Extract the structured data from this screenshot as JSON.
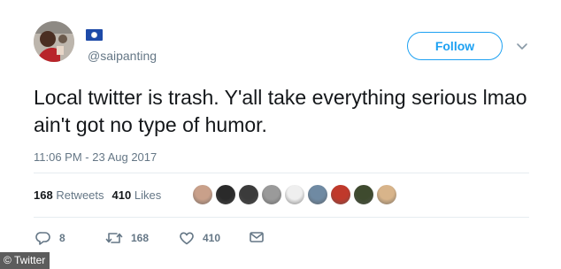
{
  "user": {
    "handle": "@saipanting",
    "flag_icon": "flag-icon",
    "colors": {
      "flag_blue": "#1d4aa8"
    }
  },
  "follow_button": {
    "label": "Follow",
    "color": "#1da1f2"
  },
  "tweet": {
    "text": "Local twitter is trash. Y'all take everything serious lmao ain't got no type of humor.",
    "timestamp": "11:06 PM - 23 Aug 2017"
  },
  "stats": {
    "retweets_count": "168",
    "retweets_label": "Retweets",
    "likes_count": "410",
    "likes_label": "Likes"
  },
  "likers": [
    {
      "icon": "liker-avatar-1",
      "color": "#c9a08a"
    },
    {
      "icon": "liker-avatar-2",
      "color": "#2a2a2a"
    },
    {
      "icon": "liker-avatar-3",
      "color": "#3b3b3b"
    },
    {
      "icon": "liker-avatar-4",
      "color": "#9a9a9a"
    },
    {
      "icon": "liker-avatar-5",
      "color": "#efefef"
    },
    {
      "icon": "liker-avatar-6",
      "color": "#6f8aa3"
    },
    {
      "icon": "liker-avatar-7",
      "color": "#c0392b"
    },
    {
      "icon": "liker-avatar-8",
      "color": "#3e4a2e"
    },
    {
      "icon": "liker-avatar-9",
      "color": "#d8b48a"
    }
  ],
  "actions": {
    "replies": {
      "count": "8",
      "icon": "reply-icon"
    },
    "retweets": {
      "count": "168",
      "icon": "retweet-icon"
    },
    "likes": {
      "count": "410",
      "icon": "heart-icon"
    },
    "message": {
      "icon": "direct-message-icon"
    }
  },
  "watermark": {
    "text": "© Twitter"
  }
}
